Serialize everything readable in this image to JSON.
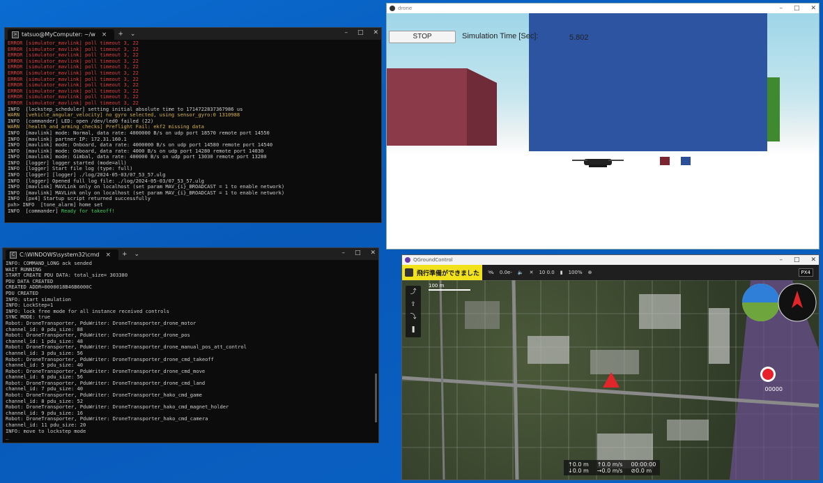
{
  "terminal1": {
    "tab_title": "tatsuo@MyComputer: ~/w",
    "lines": [
      {
        "t": "ERROR [simulator_mavlink] poll timeout 3, 22",
        "c": "err"
      },
      {
        "t": "ERROR [simulator_mavlink] poll timeout 3, 22",
        "c": "err"
      },
      {
        "t": "ERROR [simulator_mavlink] poll timeout 3, 22",
        "c": "err"
      },
      {
        "t": "ERROR [simulator_mavlink] poll timeout 3, 22",
        "c": "err"
      },
      {
        "t": "ERROR [simulator_mavlink] poll timeout 3, 22",
        "c": "err"
      },
      {
        "t": "ERROR [simulator_mavlink] poll timeout 3, 22",
        "c": "err"
      },
      {
        "t": "ERROR [simulator_mavlink] poll timeout 3, 22",
        "c": "err"
      },
      {
        "t": "ERROR [simulator_mavlink] poll timeout 3, 22",
        "c": "err"
      },
      {
        "t": "ERROR [simulator_mavlink] poll timeout 3, 22",
        "c": "err"
      },
      {
        "t": "ERROR [simulator_mavlink] poll timeout 3, 22",
        "c": "err"
      },
      {
        "t": "ERROR [simulator_mavlink] poll timeout 3, 22",
        "c": "err"
      },
      {
        "t": "INFO  [lockstep_scheduler] setting initial absolute time to 1714722837367986 us",
        "c": ""
      },
      {
        "t": "WARN  [vehicle_angular_velocity] no gyro selected, using sensor_gyro:0 1310988",
        "c": "warn"
      },
      {
        "t": "INFO  [commander] LED: open /dev/led0 failed (22)",
        "c": ""
      },
      {
        "t": "WARN  [health_and_arming_checks] Preflight Fail: ekf2 missing data",
        "c": "warn"
      },
      {
        "t": "INFO  [mavlink] mode: Normal, data rate: 4000000 B/s on udp port 18570 remote port 14550",
        "c": ""
      },
      {
        "t": "INFO  [mavlink] partner IP: 172.31.160.1",
        "c": ""
      },
      {
        "t": "INFO  [mavlink] mode: Onboard, data rate: 4000000 B/s on udp port 14580 remote port 14540",
        "c": ""
      },
      {
        "t": "INFO  [mavlink] mode: Onboard, data rate: 4000 B/s on udp port 14280 remote port 14030",
        "c": ""
      },
      {
        "t": "INFO  [mavlink] mode: Gimbal, data rate: 400000 B/s on udp port 13030 remote port 13280",
        "c": ""
      },
      {
        "t": "INFO  [logger] logger started (mode=all)",
        "c": ""
      },
      {
        "t": "INFO  [logger] Start file log (type: full)",
        "c": ""
      },
      {
        "t": "INFO  [logger] [logger] ./log/2024-05-03/07_53_57.ulg",
        "c": ""
      },
      {
        "t": "INFO  [logger] Opened full log file: ./log/2024-05-03/07_53_57.ulg",
        "c": ""
      },
      {
        "t": "INFO  [mavlink] MAVLink only on localhost (set param MAV_{i}_BROADCAST = 1 to enable network)",
        "c": ""
      },
      {
        "t": "INFO  [mavlink] MAVLink only on localhost (set param MAV_{i}_BROADCAST = 1 to enable network)",
        "c": ""
      },
      {
        "t": "INFO  [px4] Startup script returned successfully",
        "c": ""
      },
      {
        "t": "pxh> INFO  [tone_alarm] home set",
        "c": ""
      },
      {
        "t": "INFO  [commander] ",
        "c": "",
        "ok": "Ready for takeoff!"
      }
    ]
  },
  "terminal2": {
    "tab_title": "C:\\WINDOWS\\system32\\cmd",
    "lines": [
      "INFO: COMMAND_LONG ack sended",
      "WAIT RUNNING",
      "START CREATE PDU DATA: total_size= 303380",
      "PDU DATA CREATED",
      "CREATED ADDR=0000018B46B6000C",
      "PDU CREATED",
      "INFO: start simulation",
      "INFO: LockStep=1",
      "INFO: lock free mode for all instance received controls",
      "SYNC MODE: true",
      "Robot: DroneTransporter, PduWriter: DroneTransporter_drone_motor",
      "channel_id: 0 pdu_size: 88",
      "Robot: DroneTransporter, PduWriter: DroneTransporter_drone_pos",
      "channel_id: 1 pdu_size: 48",
      "Robot: DroneTransporter, PduWriter: DroneTransporter_drone_manual_pos_att_control",
      "channel_id: 3 pdu_size: 56",
      "Robot: DroneTransporter, PduWriter: DroneTransporter_drone_cmd_takeoff",
      "channel_id: 5 pdu_size: 40",
      "Robot: DroneTransporter, PduWriter: DroneTransporter_drone_cmd_move",
      "channel_id: 6 pdu_size: 56",
      "Robot: DroneTransporter, PduWriter: DroneTransporter_drone_cmd_land",
      "channel_id: 7 pdu_size: 40",
      "Robot: DroneTransporter, PduWriter: DroneTransporter_hako_cmd_game",
      "channel_id: 8 pdu_size: 52",
      "Robot: DroneTransporter, PduWriter: DroneTransporter_hako_cmd_magnet_holder",
      "channel_id: 9 pdu_size: 16",
      "Robot: DroneTransporter, PduWriter: DroneTransporter_hako_cmd_camera",
      "channel_id: 11 pdu_size: 20",
      "INFO: move to lockstep mode",
      "_"
    ]
  },
  "sim": {
    "title": "drone",
    "stop_label": "STOP",
    "time_label": "Simulation Time [Sec]:",
    "time_value": "5.802"
  },
  "qgc": {
    "title": "QGroundControl",
    "status_msg": "飛行準備ができました",
    "tb_signal": "0.0e-",
    "tb_rc": "10 0.0",
    "tb_battery": "100%",
    "scale_label": "100 m",
    "rec_count": "00000",
    "telemetry": [
      "↑0.0 m",
      "↑0.0 m/s",
      "00:00:00",
      "↓0.0 m",
      "→0.0 m/s",
      "⊘0.0 m"
    ],
    "colors": {
      "status_bg": "#f2e21b",
      "record": "#e6212b",
      "vehicle": "#e0262a"
    }
  }
}
